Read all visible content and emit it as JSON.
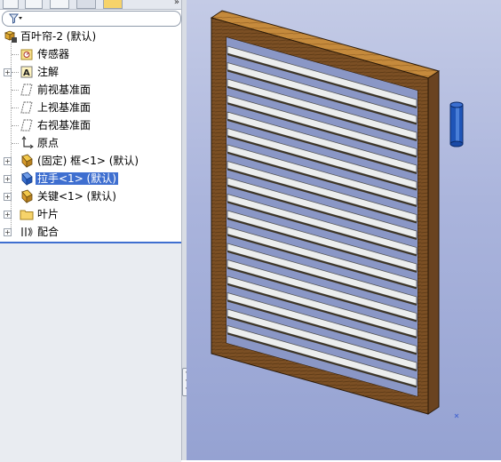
{
  "tree": {
    "root": {
      "label": "百叶帘-2 (默认)",
      "icon": "assembly-icon"
    },
    "items": [
      {
        "label": "传感器",
        "icon": "sensor-folder-icon"
      },
      {
        "label": "注解",
        "icon": "annotation-icon"
      },
      {
        "label": "前视基准面",
        "icon": "plane-icon"
      },
      {
        "label": "上视基准面",
        "icon": "plane-icon"
      },
      {
        "label": "右视基准面",
        "icon": "plane-icon"
      },
      {
        "label": "原点",
        "icon": "origin-icon"
      },
      {
        "label": "(固定) 框<1> (默认)",
        "icon": "part-icon"
      },
      {
        "label": "拉手<1> (默认)",
        "icon": "part-icon",
        "selected": true
      },
      {
        "label": "关键<1> (默认)",
        "icon": "part-icon"
      },
      {
        "label": "叶片",
        "icon": "folder-icon"
      },
      {
        "label": "配合",
        "icon": "mates-icon"
      }
    ]
  },
  "colors": {
    "selection": "#3f6fd0",
    "frame_wood": "#7a4f24",
    "handle": "#1f55b8",
    "slat": "#eceeee"
  }
}
